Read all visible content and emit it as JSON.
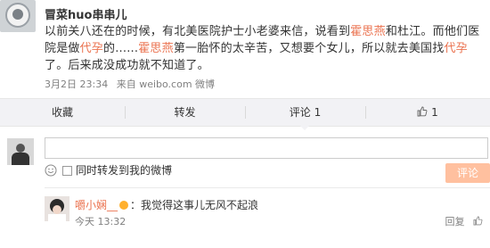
{
  "post": {
    "username": "冒菜huo串串儿",
    "content_parts": [
      "以前关八还在的时候，有北美医院护士小老婆来信，说看到",
      "霍思燕",
      "和杜江。而他们医院是做",
      "代孕",
      "的......",
      "霍思燕",
      "第一胎怀的太辛苦，又想要个女儿，所以就去美国找",
      "代孕",
      "了。后来成没成功就不知道了。"
    ],
    "timestamp": "3月2日 23:34",
    "source": "来自 weibo.com",
    "via": "微博"
  },
  "actions": {
    "collect": "收藏",
    "repost": "转发",
    "comment": "评论 1",
    "like": "1"
  },
  "composer": {
    "placeholder": "",
    "repost_label": "同时转发到我的微博",
    "submit_label": "评论"
  },
  "reply": {
    "user": "嚼小娴__",
    "text": "：我觉得这事儿无风不起浪",
    "time": "今天 13:32",
    "reply_label": "回复",
    "like_icon_label": "赞"
  },
  "colors": {
    "highlight": "#eb7350",
    "submit_disabled": "#ffc09f",
    "action_bar": "#f2f2f5"
  }
}
